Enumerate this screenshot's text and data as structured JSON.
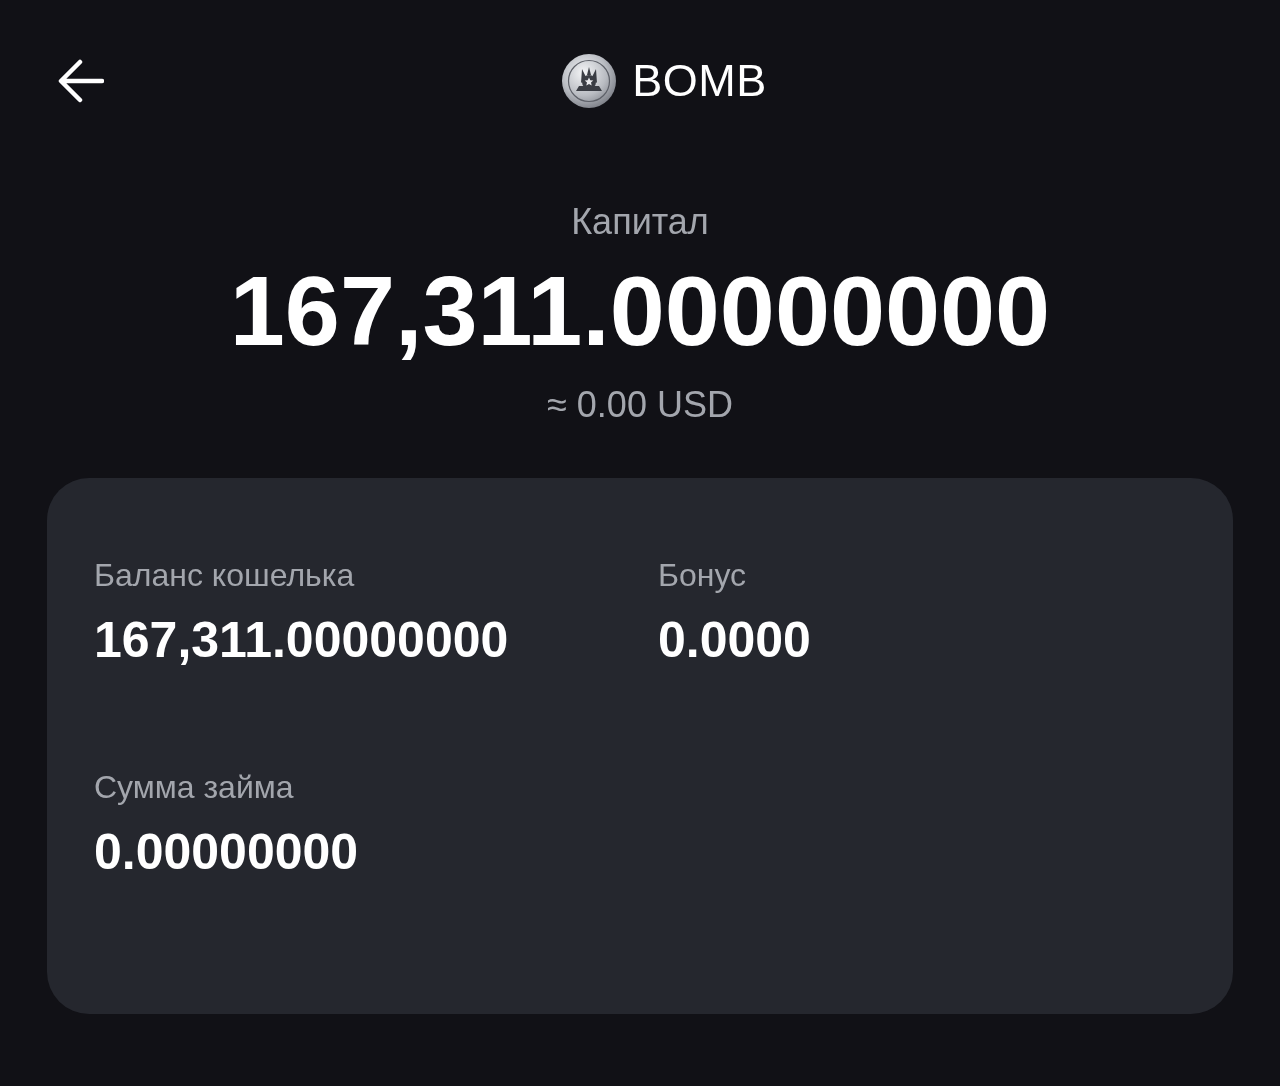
{
  "header": {
    "title": "BOMB"
  },
  "capital": {
    "label": "Капитал",
    "amount": "167,311.00000000",
    "usd_equivalent": "≈ 0.00 USD"
  },
  "details": [
    {
      "label": "Баланс кошелька",
      "value": "167,311.00000000"
    },
    {
      "label": "Бонус",
      "value": "0.0000"
    },
    {
      "label": "Сумма займа",
      "value": "0.00000000"
    }
  ]
}
